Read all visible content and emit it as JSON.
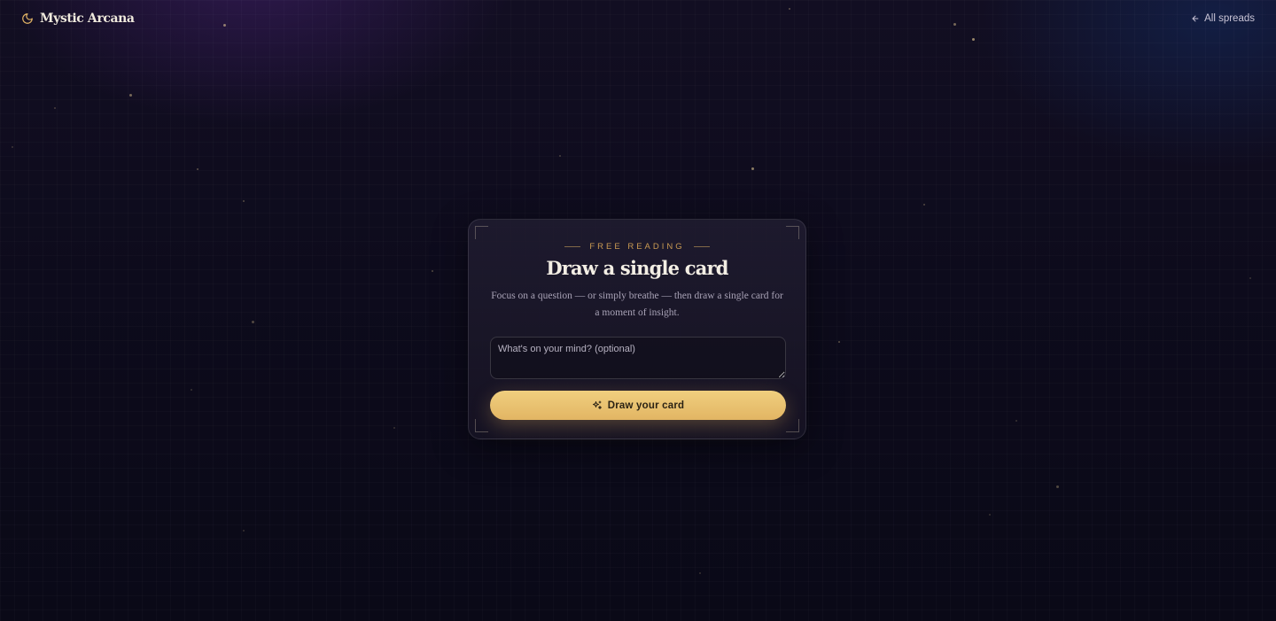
{
  "header": {
    "brand_name": "Mystic Arcana",
    "brand_icon": "crescent-moon-icon",
    "back_label": "All spreads",
    "back_icon": "arrow-left-icon"
  },
  "reading_card": {
    "eyebrow": "FREE READING",
    "title": "Draw a single card",
    "description": "Focus on a question — or simply breathe — then draw a single card for a moment of insight.",
    "question_placeholder": "What's on your mind? (optional)",
    "question_value": "",
    "draw_button_label": "Draw your card",
    "draw_button_icon": "sparkles-icon"
  },
  "colors": {
    "background": "#0d0b1c",
    "accent_gold": "#e8c16e",
    "eyebrow_gold": "#c99a52",
    "title_text": "#f3eee4"
  }
}
